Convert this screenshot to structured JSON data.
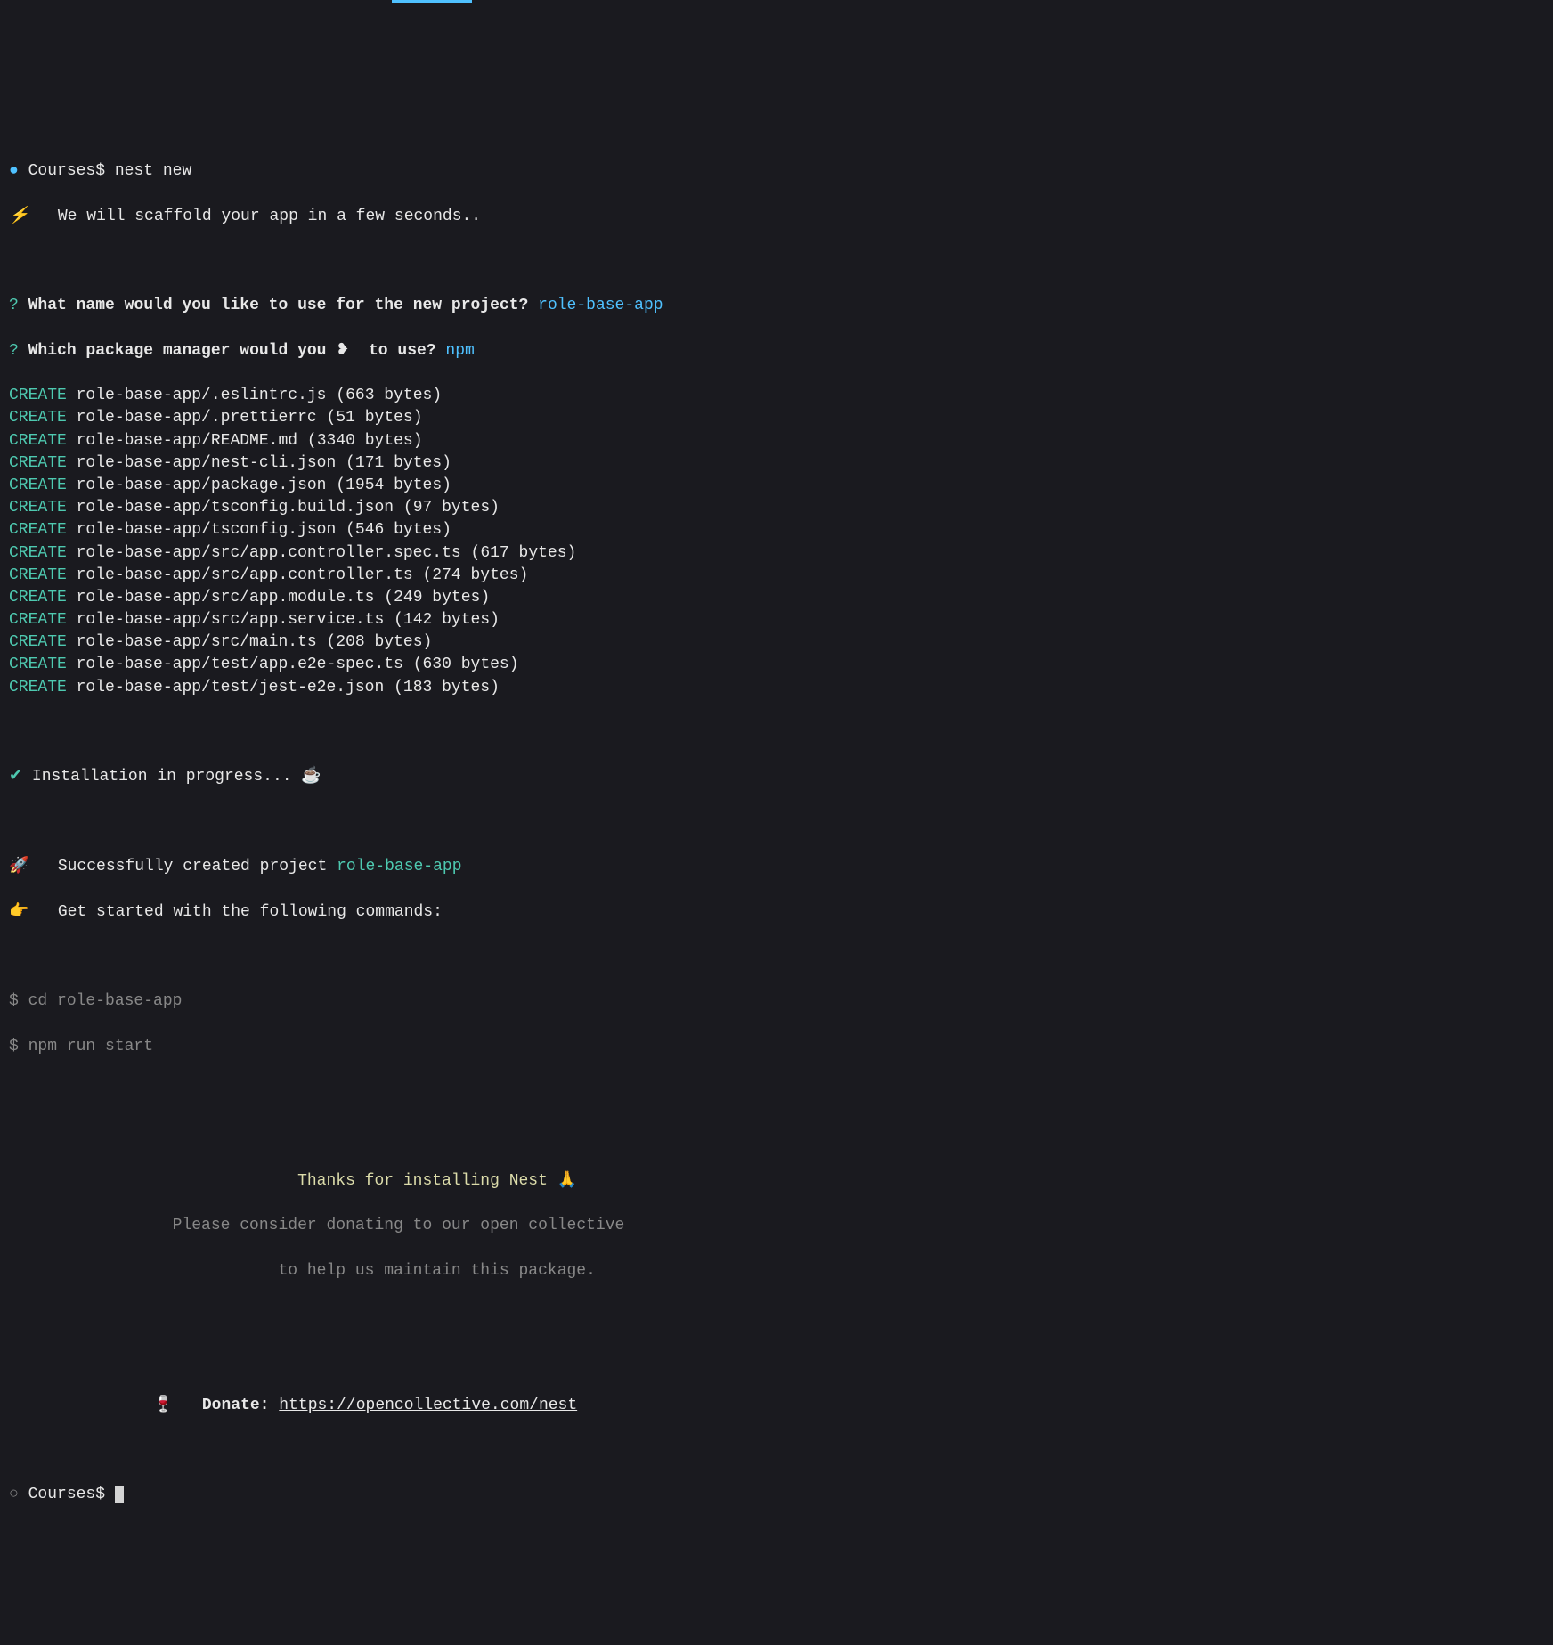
{
  "top": {
    "prompt_path": "Courses$",
    "command": "nest new",
    "scaffold_icon": "⚡",
    "scaffold_msg": "We will scaffold your app in a few seconds.."
  },
  "questions": {
    "q_mark": "?",
    "q1": "What name would you like to use for the new project?",
    "a1": "role-base-app",
    "q2_a": "Which package manager would you ",
    "heart": "❥",
    "q2_b": " to use?",
    "a2": "npm"
  },
  "create_label": "CREATE",
  "files": [
    {
      "path": "role-base-app/.eslintrc.js",
      "size": "(663 bytes)"
    },
    {
      "path": "role-base-app/.prettierrc",
      "size": "(51 bytes)"
    },
    {
      "path": "role-base-app/README.md",
      "size": "(3340 bytes)"
    },
    {
      "path": "role-base-app/nest-cli.json",
      "size": "(171 bytes)"
    },
    {
      "path": "role-base-app/package.json",
      "size": "(1954 bytes)"
    },
    {
      "path": "role-base-app/tsconfig.build.json",
      "size": "(97 bytes)"
    },
    {
      "path": "role-base-app/tsconfig.json",
      "size": "(546 bytes)"
    },
    {
      "path": "role-base-app/src/app.controller.spec.ts",
      "size": "(617 bytes)"
    },
    {
      "path": "role-base-app/src/app.controller.ts",
      "size": "(274 bytes)"
    },
    {
      "path": "role-base-app/src/app.module.ts",
      "size": "(249 bytes)"
    },
    {
      "path": "role-base-app/src/app.service.ts",
      "size": "(142 bytes)"
    },
    {
      "path": "role-base-app/src/main.ts",
      "size": "(208 bytes)"
    },
    {
      "path": "role-base-app/test/app.e2e-spec.ts",
      "size": "(630 bytes)"
    },
    {
      "path": "role-base-app/test/jest-e2e.json",
      "size": "(183 bytes)"
    }
  ],
  "install": {
    "check": "✔",
    "text": "Installation in progress... ",
    "coffee": "☕"
  },
  "success": {
    "rocket": "🚀",
    "text": "Successfully created project ",
    "project": "role-base-app",
    "hand": "👉",
    "get_started": "Get started with the following commands:",
    "cmd1_prefix": "$ ",
    "cmd1": "cd role-base-app",
    "cmd2_prefix": "$ ",
    "cmd2": "npm run start"
  },
  "thanks": {
    "line1": "Thanks for installing Nest ",
    "pray": "🙏",
    "line2": "Please consider donating to our open collective",
    "line3": "to help us maintain this package.",
    "wine": "🍷",
    "donate_label": "Donate:",
    "donate_url": "https://opencollective.com/nest"
  },
  "bottom": {
    "prompt_path": "Courses$"
  }
}
